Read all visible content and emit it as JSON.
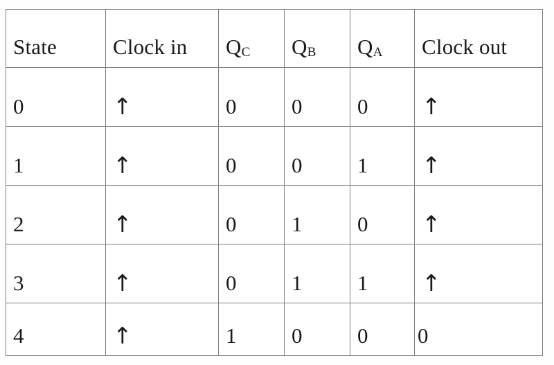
{
  "table": {
    "columns": [
      {
        "key": "state",
        "label": "State",
        "label_base": "State",
        "label_sub": ""
      },
      {
        "key": "clock_in",
        "label": "Clock in",
        "label_base": "Clock in",
        "label_sub": ""
      },
      {
        "key": "qc",
        "label": "QC",
        "label_base": "Q",
        "label_sub": "C"
      },
      {
        "key": "qb",
        "label": "QB",
        "label_base": "Q",
        "label_sub": "B"
      },
      {
        "key": "qa",
        "label": "QA",
        "label_base": "Q",
        "label_sub": "A"
      },
      {
        "key": "clock_out",
        "label": "Clock out",
        "label_base": "Clock out",
        "label_sub": ""
      }
    ],
    "rows": [
      {
        "state": "0",
        "clock_in": "↑",
        "qc": "0",
        "qb": "0",
        "qa": "0",
        "clock_out": "↑"
      },
      {
        "state": "1",
        "clock_in": "↑",
        "qc": "0",
        "qb": "0",
        "qa": "1",
        "clock_out": "↑"
      },
      {
        "state": "2",
        "clock_in": "↑",
        "qc": "0",
        "qb": "1",
        "qa": "0",
        "clock_out": "↑"
      },
      {
        "state": "3",
        "clock_in": "↑",
        "qc": "0",
        "qb": "1",
        "qa": "1",
        "clock_out": "↑"
      },
      {
        "state": "4",
        "clock_in": "↑",
        "qc": "1",
        "qb": "0",
        "qa": "0",
        "clock_out": "0"
      }
    ]
  },
  "style": {
    "border_color": "#7d7d7d",
    "text_color": "#1a1a1a",
    "background": "#ffffff"
  }
}
